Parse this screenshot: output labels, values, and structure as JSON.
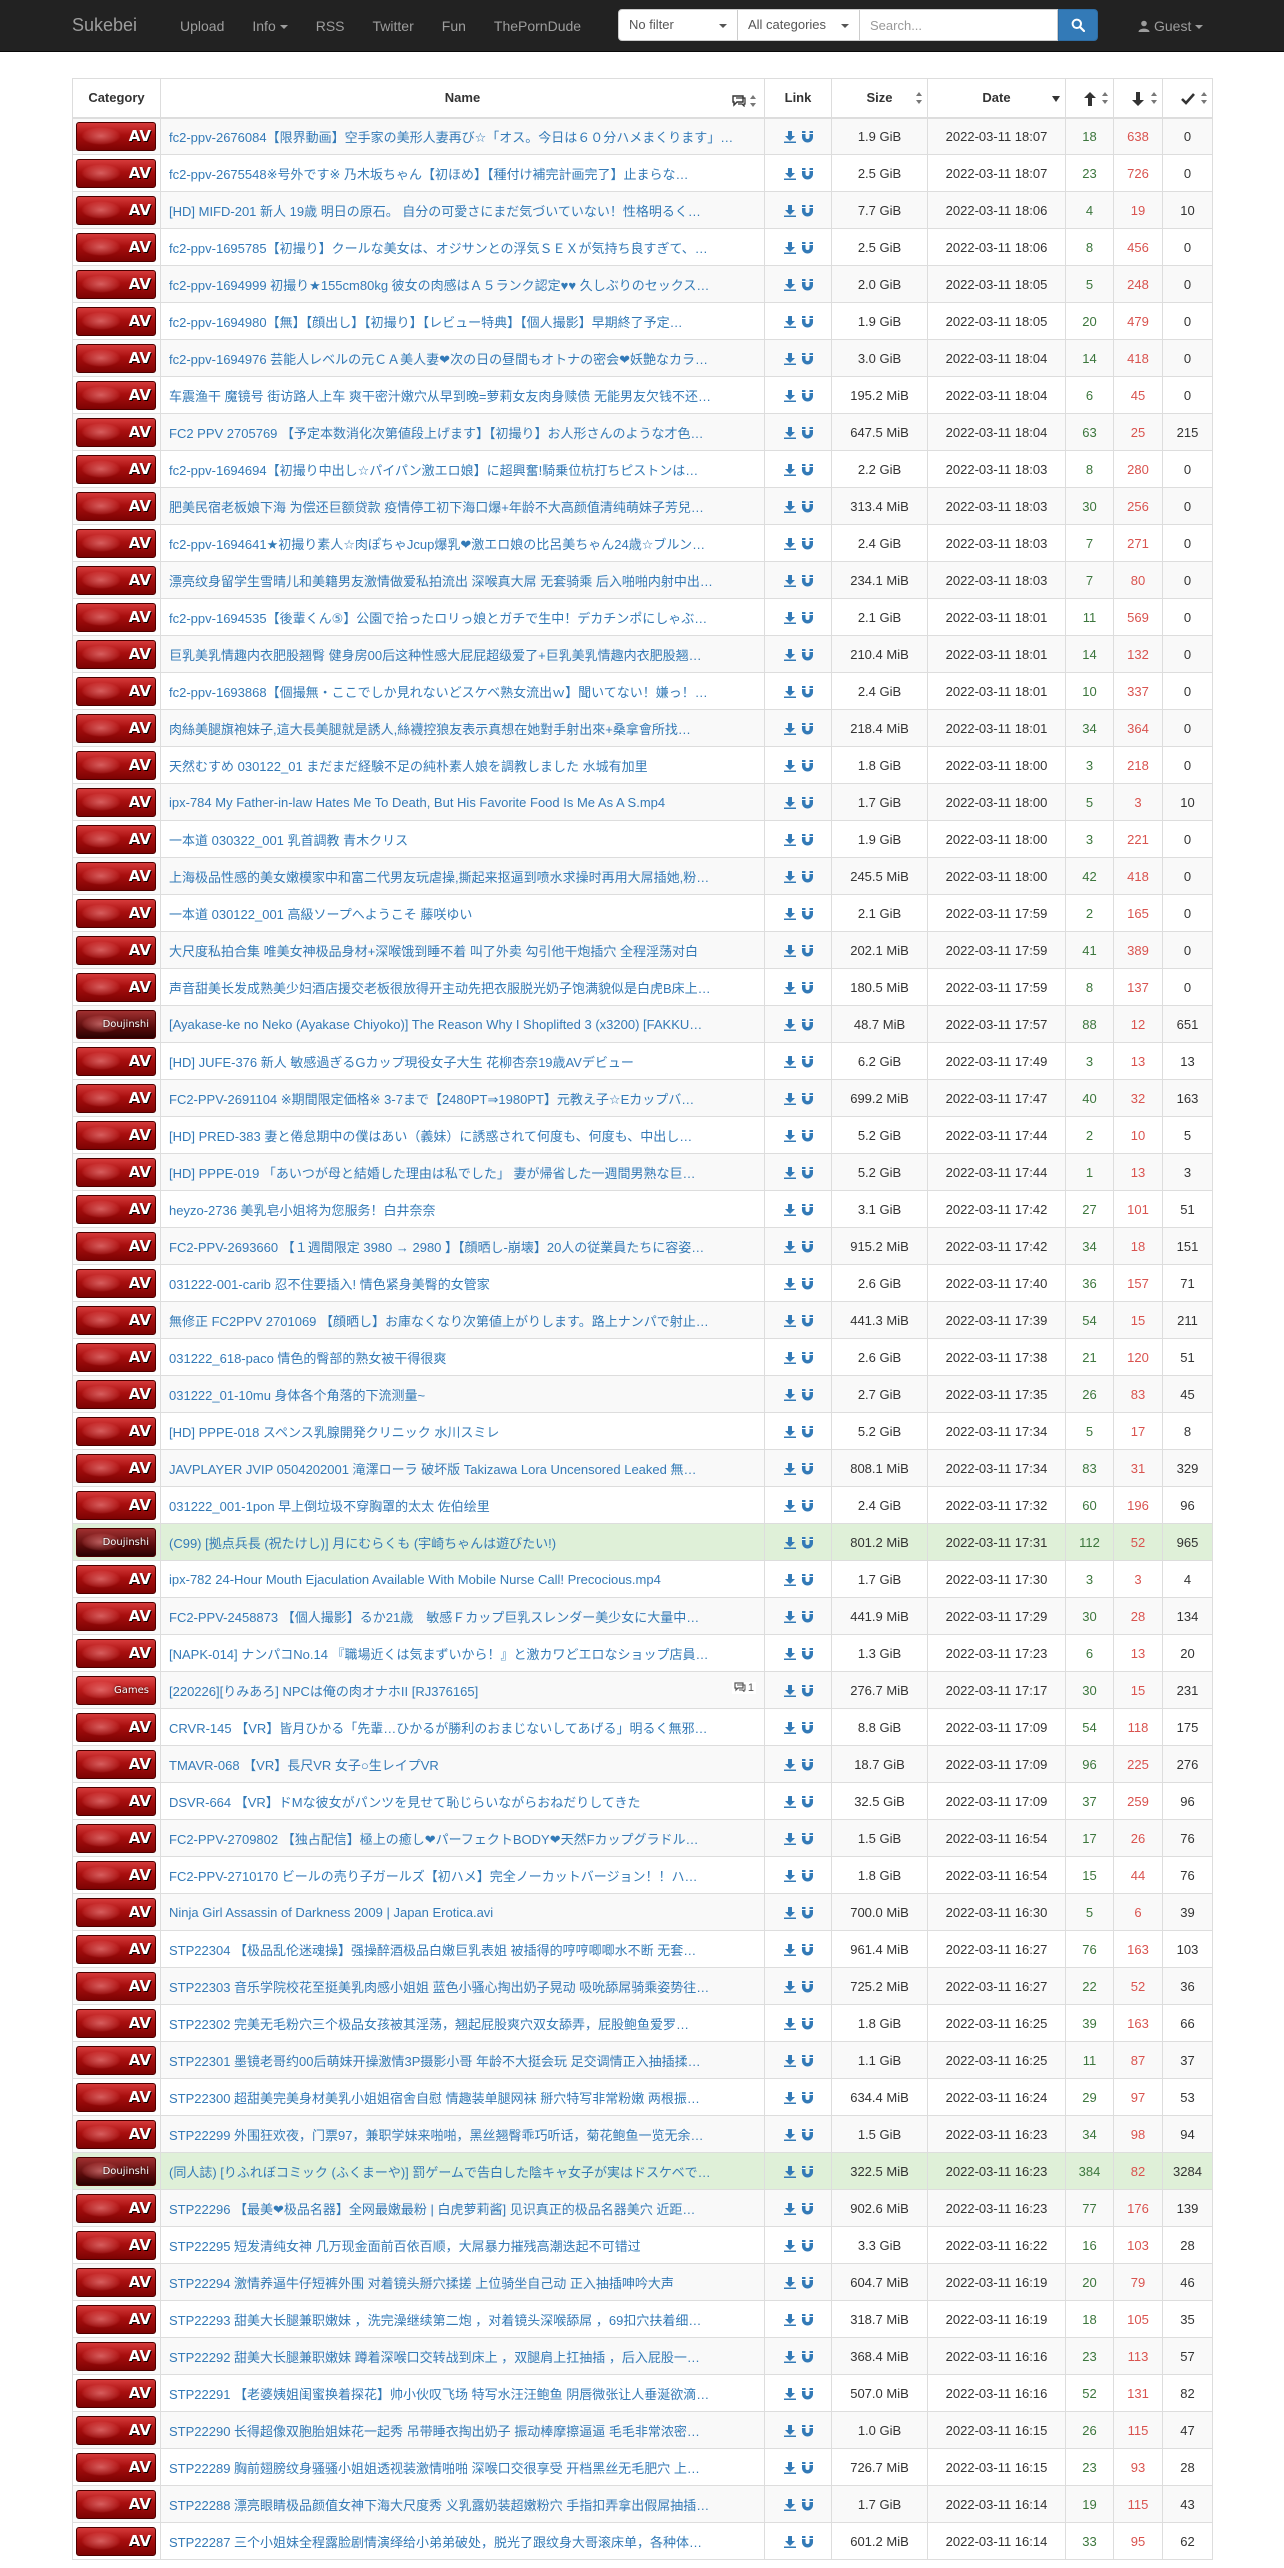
{
  "nav": {
    "brand": "Sukebei",
    "upload": "Upload",
    "info": "Info",
    "rss": "RSS",
    "twitter": "Twitter",
    "fun": "Fun",
    "porndude": "ThePornDude",
    "filter": "No filter",
    "category": "All categories",
    "search_placeholder": "Search...",
    "guest": "Guest"
  },
  "headers": {
    "category": "Category",
    "name": "Name",
    "link": "Link",
    "size": "Size",
    "date": "Date"
  },
  "colors": {
    "navbar": "#222222",
    "link": "#337ab7",
    "seeders": "#3c763d",
    "leechers": "#d9534f",
    "trusted_row": "#dff0d8"
  },
  "rows": [
    {
      "cat": "AV",
      "name": "fc2-ppv-2676084【限界動画】空手家の美形人妻再び☆「オス。今日は６０分ハメまくります」…",
      "size": "1.9 GiB",
      "date": "2022-03-11 18:07",
      "seed": "18",
      "leech": "638",
      "done": "0"
    },
    {
      "cat": "AV",
      "name": "fc2-ppv-2675548※号外です※ 乃木坂ちゃん【初ほめ】【種付け補完計画完了】止まらな…",
      "size": "2.5 GiB",
      "date": "2022-03-11 18:07",
      "seed": "23",
      "leech": "726",
      "done": "0"
    },
    {
      "cat": "AV",
      "name": " [HD] MIFD-201 新人 19歳 明日の原石。 自分の可愛さにまだ気づいていない！性格明るく…",
      "size": "7.7 GiB",
      "date": "2022-03-11 18:06",
      "seed": "4",
      "leech": "19",
      "done": "10"
    },
    {
      "cat": "AV",
      "name": "fc2-ppv-1695785【初撮り】クールな美女は、オジサンとの浮気ＳＥＸが気持ち良すぎて、…",
      "size": "2.5 GiB",
      "date": "2022-03-11 18:06",
      "seed": "8",
      "leech": "456",
      "done": "0"
    },
    {
      "cat": "AV",
      "name": "fc2-ppv-1694999 初撮り★155cm80kg 彼女の肉感はＡ５ランク認定♥♥ 久しぶりのセックス…",
      "size": "2.0 GiB",
      "date": "2022-03-11 18:05",
      "seed": "5",
      "leech": "248",
      "done": "0"
    },
    {
      "cat": "AV",
      "name": "fc2-ppv-1694980【無】【顔出し】【初撮り】【レビュー特典】【個人撮影】早期終了予定…",
      "size": "1.9 GiB",
      "date": "2022-03-11 18:05",
      "seed": "20",
      "leech": "479",
      "done": "0"
    },
    {
      "cat": "AV",
      "name": "fc2-ppv-1694976 芸能人レベルの元ＣＡ美人妻❤次の日の昼間もオトナの密会❤妖艶なカラ…",
      "size": "3.0 GiB",
      "date": "2022-03-11 18:04",
      "seed": "14",
      "leech": "418",
      "done": "0"
    },
    {
      "cat": "AV",
      "name": "车震渔干 魔镜号 街访路人上车 爽干密汁嫩穴从早到晚=萝莉女友肉身赎债 无能男友欠钱不还…",
      "size": "195.2 MiB",
      "date": "2022-03-11 18:04",
      "seed": "6",
      "leech": "45",
      "done": "0"
    },
    {
      "cat": "AV",
      "name": "FC2 PPV 2705769 【予定本数消化次第値段上げます】【初撮り】お人形さんのような才色…",
      "size": "647.5 MiB",
      "date": "2022-03-11 18:04",
      "seed": "63",
      "leech": "25",
      "done": "215"
    },
    {
      "cat": "AV",
      "name": "fc2-ppv-1694694【初撮り中出し☆パイパン激エロ娘】に超興奮!騎乗位杭打ちピストンは…",
      "size": "2.2 GiB",
      "date": "2022-03-11 18:03",
      "seed": "8",
      "leech": "280",
      "done": "0"
    },
    {
      "cat": "AV",
      "name": "肥美民宿老板娘下海 为偿还巨额贷款 疫情停工初下海口爆+年龄不大高颜值清纯萌妹子芳兒…",
      "size": "313.4 MiB",
      "date": "2022-03-11 18:03",
      "seed": "30",
      "leech": "256",
      "done": "0"
    },
    {
      "cat": "AV",
      "name": "fc2-ppv-1694641★初撮り素人☆肉ぽちゃJcup爆乳❤激エロ娘の比呂美ちゃん24歳☆ブルン…",
      "size": "2.4 GiB",
      "date": "2022-03-11 18:03",
      "seed": "7",
      "leech": "271",
      "done": "0"
    },
    {
      "cat": "AV",
      "name": "漂亮纹身留学生雪晴儿和美籍男友激情做爱私拍流出 深喉真大屌 无套骑乘 后入啪啪内射中出…",
      "size": "234.1 MiB",
      "date": "2022-03-11 18:03",
      "seed": "7",
      "leech": "80",
      "done": "0"
    },
    {
      "cat": "AV",
      "name": "fc2-ppv-1694535【後輩くん⑤】公園で拾ったロリっ娘とガチで生中！デカチンポにしゃぶ…",
      "size": "2.1 GiB",
      "date": "2022-03-11 18:01",
      "seed": "11",
      "leech": "569",
      "done": "0"
    },
    {
      "cat": "AV",
      "name": "巨乳美乳情趣内衣肥股翘臀 健身房00后这种性感大屁屁超级爱了+巨乳美乳情趣内衣肥股翘…",
      "size": "210.4 MiB",
      "date": "2022-03-11 18:01",
      "seed": "14",
      "leech": "132",
      "done": "0"
    },
    {
      "cat": "AV",
      "name": "fc2-ppv-1693868【個撮無・ここでしか見れないどスケベ熟女流出ｗ】聞いてない！嫌っ！…",
      "size": "2.4 GiB",
      "date": "2022-03-11 18:01",
      "seed": "10",
      "leech": "337",
      "done": "0"
    },
    {
      "cat": "AV",
      "name": "肉絲美腿旗袍妹子,這大長美腿就是誘人,絲襪控狼友表示真想在她對手射出來+桑拿會所找…",
      "size": "218.4 MiB",
      "date": "2022-03-11 18:01",
      "seed": "34",
      "leech": "364",
      "done": "0"
    },
    {
      "cat": "AV",
      "name": "天然むすめ 030122_01 まだまだ経験不足の純朴素人娘を調教しました 水城有加里",
      "size": "1.8 GiB",
      "date": "2022-03-11 18:00",
      "seed": "3",
      "leech": "218",
      "done": "0"
    },
    {
      "cat": "AV",
      "name": "ipx-784 My Father-in-law Hates Me To Death, But His Favorite Food Is Me As A S.mp4",
      "size": "1.7 GiB",
      "date": "2022-03-11 18:00",
      "seed": "5",
      "leech": "3",
      "done": "10"
    },
    {
      "cat": "AV",
      "name": "一本道 030322_001 乳首調教 青木クリス",
      "size": "1.9 GiB",
      "date": "2022-03-11 18:00",
      "seed": "3",
      "leech": "221",
      "done": "0"
    },
    {
      "cat": "AV",
      "name": "上海极品性感的美女嫩模家中和富二代男友玩虐操,撕起来抠逼到喷水求操时再用大屌插她,粉…",
      "size": "245.5 MiB",
      "date": "2022-03-11 18:00",
      "seed": "42",
      "leech": "418",
      "done": "0"
    },
    {
      "cat": "AV",
      "name": "一本道 030122_001 高級ソープへようこそ 藤咲ゆい",
      "size": "2.1 GiB",
      "date": "2022-03-11 17:59",
      "seed": "2",
      "leech": "165",
      "done": "0"
    },
    {
      "cat": "AV",
      "name": "大尺度私拍合集 唯美女神极品身材+深喉饿到睡不着 叫了外卖 勾引他干炮插穴 全程淫荡对白",
      "size": "202.1 MiB",
      "date": "2022-03-11 17:59",
      "seed": "41",
      "leech": "389",
      "done": "0"
    },
    {
      "cat": "AV",
      "name": "声音甜美长发成熟美少妇酒店援交老板很放得开主动先把衣服脱光奶子饱满貌似是白虎B床上…",
      "size": "180.5 MiB",
      "date": "2022-03-11 17:59",
      "seed": "8",
      "leech": "137",
      "done": "0"
    },
    {
      "cat": "Doujinshi",
      "name": "[Ayakase-ke no Neko (Ayakase Chiyoko)] The Reason Why I Shoplifted 3 (x3200) [FAKKU…",
      "size": "48.7 MiB",
      "date": "2022-03-11 17:57",
      "seed": "88",
      "leech": "12",
      "done": "651"
    },
    {
      "cat": "AV",
      "name": " [HD] JUFE-376 新人 敏感過ぎるGカップ現役女子大生 花柳杏奈19歳AVデビュー",
      "size": "6.2 GiB",
      "date": "2022-03-11 17:49",
      "seed": "3",
      "leech": "13",
      "done": "13"
    },
    {
      "cat": "AV",
      "name": "FC2-PPV-2691104 ※期間限定価格※ 3-7まで【2480PT⇒1980PT】元教え子☆Eカップバ…",
      "size": "699.2 MiB",
      "date": "2022-03-11 17:47",
      "seed": "40",
      "leech": "32",
      "done": "163"
    },
    {
      "cat": "AV",
      "name": " [HD] PRED-383 妻と倦怠期中の僕はあい（義妹）に誘惑されて何度も、何度も、中出し…",
      "size": "5.2 GiB",
      "date": "2022-03-11 17:44",
      "seed": "2",
      "leech": "10",
      "done": "5"
    },
    {
      "cat": "AV",
      "name": " [HD] PPPE-019 「あいつが母と結婚した理由は私でした」 妻が帰省した一週間男熟な巨…",
      "size": "5.2 GiB",
      "date": "2022-03-11 17:44",
      "seed": "1",
      "leech": "13",
      "done": "3"
    },
    {
      "cat": "AV",
      "name": "heyzo-2736 美乳皂小姐将为您服务！白井奈奈",
      "size": "3.1 GiB",
      "date": "2022-03-11 17:42",
      "seed": "27",
      "leech": "101",
      "done": "51"
    },
    {
      "cat": "AV",
      "name": "FC2-PPV-2693660 【１週間限定 3980 → 2980 】【顔晒し-崩壊】20人の従業員たちに容姿…",
      "size": "915.2 MiB",
      "date": "2022-03-11 17:42",
      "seed": "34",
      "leech": "18",
      "done": "151"
    },
    {
      "cat": "AV",
      "name": "031222-001-carib 忍不住要插入! 情色紧身美臀的女管家",
      "size": "2.6 GiB",
      "date": "2022-03-11 17:40",
      "seed": "36",
      "leech": "157",
      "done": "71"
    },
    {
      "cat": "AV",
      "name": "無修正 FC2PPV 2701069 【顔晒し】お庫なくなり次第値上がりします。路上ナンパで射止…",
      "size": "441.3 MiB",
      "date": "2022-03-11 17:39",
      "seed": "54",
      "leech": "15",
      "done": "211"
    },
    {
      "cat": "AV",
      "name": "031222_618-paco 情色的臀部的熟女被干得很爽",
      "size": "2.6 GiB",
      "date": "2022-03-11 17:38",
      "seed": "21",
      "leech": "120",
      "done": "51"
    },
    {
      "cat": "AV",
      "name": "031222_01-10mu 身体各个角落的下流测量~",
      "size": "2.7 GiB",
      "date": "2022-03-11 17:35",
      "seed": "26",
      "leech": "83",
      "done": "45"
    },
    {
      "cat": "AV",
      "name": " [HD] PPPE-018 スペンス乳腺開発クリニック 水川スミレ",
      "size": "5.2 GiB",
      "date": "2022-03-11 17:34",
      "seed": "5",
      "leech": "17",
      "done": "8"
    },
    {
      "cat": "AV",
      "name": "JAVPLAYER JVIP 0504202001 滝澤ローラ 破坏版 Takizawa Lora Uncensored Leaked 無…",
      "size": "808.1 MiB",
      "date": "2022-03-11 17:34",
      "seed": "83",
      "leech": "31",
      "done": "329"
    },
    {
      "cat": "AV",
      "name": "031222_001-1pon 早上倒垃圾不穿胸罩的太太 佐伯绘里",
      "size": "2.4 GiB",
      "date": "2022-03-11 17:32",
      "seed": "60",
      "leech": "196",
      "done": "96"
    },
    {
      "cat": "Doujinshi",
      "name": "(C99) [拠点兵長 (祝たけし)] 月にむらくも (宇崎ちゃんは遊びたい!)",
      "size": "801.2 MiB",
      "date": "2022-03-11 17:31",
      "seed": "112",
      "leech": "52",
      "done": "965",
      "trusted": true
    },
    {
      "cat": "AV",
      "name": "ipx-782 24-Hour Mouth Ejaculation Available With Mobile Nurse Call! Precocious.mp4",
      "size": "1.7 GiB",
      "date": "2022-03-11 17:30",
      "seed": "3",
      "leech": "3",
      "done": "4"
    },
    {
      "cat": "AV",
      "name": "FC2-PPV-2458873 【個人撮影】るか21歳　敏感Ｆカップ巨乳スレンダー美少女に大量中…",
      "size": "441.9 MiB",
      "date": "2022-03-11 17:29",
      "seed": "30",
      "leech": "28",
      "done": "134"
    },
    {
      "cat": "AV",
      "name": "[NAPK-014] ナンパコNo.14 『職場近くは気まずいから！』と激カワどエロなショップ店員…",
      "size": "1.3 GiB",
      "date": "2022-03-11 17:23",
      "seed": "6",
      "leech": "13",
      "done": "20"
    },
    {
      "cat": "Games",
      "name": "[220226][りみあろ] NPCは俺の肉オナホII [RJ376165]",
      "size": "276.7 MiB",
      "date": "2022-03-11 17:17",
      "seed": "30",
      "leech": "15",
      "done": "231",
      "comments": "1"
    },
    {
      "cat": "AV",
      "name": "CRVR-145 【VR】皆月ひかる「先輩…ひかるが勝利のおまじないしてあげる」明るく無邪…",
      "size": "8.8 GiB",
      "date": "2022-03-11 17:09",
      "seed": "54",
      "leech": "118",
      "done": "175"
    },
    {
      "cat": "AV",
      "name": "TMAVR-068 【VR】長尺VR 女子○生レイプVR",
      "size": "18.7 GiB",
      "date": "2022-03-11 17:09",
      "seed": "96",
      "leech": "225",
      "done": "276"
    },
    {
      "cat": "AV",
      "name": "DSVR-664 【VR】ドMな彼女がパンツを見せて恥じらいながらおねだりしてきた",
      "size": "32.5 GiB",
      "date": "2022-03-11 17:09",
      "seed": "37",
      "leech": "259",
      "done": "96"
    },
    {
      "cat": "AV",
      "name": " FC2-PPV-2709802 【独占配信】極上の癒し❤パーフェクトBODY❤天然Fカップグラドル…",
      "size": "1.5 GiB",
      "date": "2022-03-11 16:54",
      "seed": "17",
      "leech": "26",
      "done": "76"
    },
    {
      "cat": "AV",
      "name": " FC2-PPV-2710170 ビールの売り子ガールズ【初ハメ】完全ノーカットバージョン！！ハ…",
      "size": "1.8 GiB",
      "date": "2022-03-11 16:54",
      "seed": "15",
      "leech": "44",
      "done": "76"
    },
    {
      "cat": "AV",
      "name": "Ninja Girl Assassin of Darkness 2009 | Japan Erotica.avi",
      "size": "700.0 MiB",
      "date": "2022-03-11 16:30",
      "seed": "5",
      "leech": "6",
      "done": "39"
    },
    {
      "cat": "AV",
      "name": "STP22304 【极品乱伦迷魂操】强操醉酒极品白嫩巨乳表姐 被插得的哼哼唧唧水不断 无套…",
      "size": "961.4 MiB",
      "date": "2022-03-11 16:27",
      "seed": "76",
      "leech": "163",
      "done": "103"
    },
    {
      "cat": "AV",
      "name": "STP22303 音乐学院校花至挺美乳肉感小姐姐 蓝色小骚心掏出奶子晃动 吸吮舔屌骑乘姿势往…",
      "size": "725.2 MiB",
      "date": "2022-03-11 16:27",
      "seed": "22",
      "leech": "52",
      "done": "36"
    },
    {
      "cat": "AV",
      "name": "STP22302 完美无毛粉穴三个极品女孩被其淫荡，翘起屁股爽穴双女舔弄，屁股鲍鱼爱罗…",
      "size": "1.8 GiB",
      "date": "2022-03-11 16:25",
      "seed": "39",
      "leech": "163",
      "done": "66"
    },
    {
      "cat": "AV",
      "name": "STP22301 墨镜老哥约00后萌妹开操激情3P摄影小哥 年龄不大挺会玩 足交调情正入抽插揉…",
      "size": "1.1 GiB",
      "date": "2022-03-11 16:25",
      "seed": "11",
      "leech": "87",
      "done": "37"
    },
    {
      "cat": "AV",
      "name": "STP22300 超甜美完美身材美乳小姐姐宿舍自慰 情趣装单腿网袜 掰穴特写非常粉嫩 两根振…",
      "size": "634.4 MiB",
      "date": "2022-03-11 16:24",
      "seed": "29",
      "leech": "97",
      "done": "53"
    },
    {
      "cat": "AV",
      "name": "STP22299 外围狂欢夜，门票97，兼职学妹来啪啪，黑丝翘臀乖巧听话，菊花鲍鱼一览无余…",
      "size": "1.5 GiB",
      "date": "2022-03-11 16:23",
      "seed": "34",
      "leech": "98",
      "done": "94"
    },
    {
      "cat": "Doujinshi",
      "name": "(同人誌) [りふれぼコミック (ふくまーや)] 罰ゲームで告白した陰キャ女子が実はドスケベで…",
      "size": "322.5 MiB",
      "date": "2022-03-11 16:23",
      "seed": "384",
      "leech": "82",
      "done": "3284",
      "trusted": true
    },
    {
      "cat": "AV",
      "name": "STP22296 【最美❤极品名器】全网最嫩最粉 | 白虎萝莉酱] 见识真正的极品名器美穴 近距…",
      "size": "902.6 MiB",
      "date": "2022-03-11 16:23",
      "seed": "77",
      "leech": "176",
      "done": "139"
    },
    {
      "cat": "AV",
      "name": "STP22295 短发清纯女神 几万现金面前百依百顺，大屌暴力摧残高潮迭起不可错过",
      "size": "3.3 GiB",
      "date": "2022-03-11 16:22",
      "seed": "16",
      "leech": "103",
      "done": "28"
    },
    {
      "cat": "AV",
      "name": "STP22294 激情养逼牛仔短裤外围 对着镜头掰穴揉搓 上位骑坐自己动 正入抽插呻吟大声",
      "size": "604.7 MiB",
      "date": "2022-03-11 16:19",
      "seed": "20",
      "leech": "79",
      "done": "46"
    },
    {
      "cat": "AV",
      "name": "STP22293 甜美大长腿兼职嫩妹 ，洗完澡继续第二炮 ，对着镜头深喉舔屌 ，69扣穴扶着细…",
      "size": "318.7 MiB",
      "date": "2022-03-11 16:19",
      "seed": "18",
      "leech": "105",
      "done": "35"
    },
    {
      "cat": "AV",
      "name": "STP22292 甜美大长腿兼职嫩妹 蹲着深喉口交转战到床上 ，双腿肩上扛抽插 ，后入屁股一…",
      "size": "368.4 MiB",
      "date": "2022-03-11 16:16",
      "seed": "23",
      "leech": "113",
      "done": "57"
    },
    {
      "cat": "AV",
      "name": "STP22291 【老婆姨姐闺蜜换着探花】帅小伙叹飞场 特写水汪汪鲍鱼 阴唇微张让人垂涎欲滴…",
      "size": "507.0 MiB",
      "date": "2022-03-11 16:16",
      "seed": "52",
      "leech": "131",
      "done": "82"
    },
    {
      "cat": "AV",
      "name": "STP22290 长得超像双胞胎姐妹花一起秀 吊带睡衣掏出奶子 振动棒摩擦逼逼 毛毛非常浓密…",
      "size": "1.0 GiB",
      "date": "2022-03-11 16:15",
      "seed": "26",
      "leech": "115",
      "done": "47"
    },
    {
      "cat": "AV",
      "name": "STP22289 胸前翅膀纹身骚骚小姐姐透视装激情啪啪 深喉口交很享受 开档黑丝无毛肥穴 上…",
      "size": "726.7 MiB",
      "date": "2022-03-11 16:15",
      "seed": "23",
      "leech": "93",
      "done": "28"
    },
    {
      "cat": "AV",
      "name": "STP22288 漂亮眼睛极品颜值女神下海大尺度秀 义乳露奶装超嫩粉穴 手指扣弄拿出假屌抽插…",
      "size": "1.7 GiB",
      "date": "2022-03-11 16:14",
      "seed": "19",
      "leech": "115",
      "done": "43"
    },
    {
      "cat": "AV",
      "name": "STP22287 三个小姐妹全程露脸剧情演绎给小弟弟破处，脱光了跟纹身大哥滚床单，各种体…",
      "size": "601.2 MiB",
      "date": "2022-03-11 16:14",
      "seed": "33",
      "leech": "95",
      "done": "62"
    }
  ]
}
